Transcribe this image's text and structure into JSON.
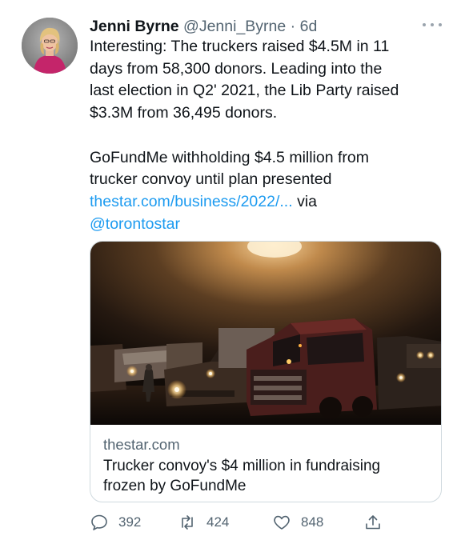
{
  "author": {
    "name": "Jenni Byrne",
    "handle": "@Jenni_Byrne",
    "separator": "·",
    "time": "6d"
  },
  "tweet": {
    "lines": [
      "Interesting: The truckers raised $4.5M in 11",
      "days from 58,300 donors. Leading into the",
      "last election in Q2' 2021, the Lib Party raised",
      "$3.3M from 36,495 donors."
    ],
    "headline_lines": [
      "GoFundMe withholding $4.5 million from",
      "trucker convoy until plan presented"
    ],
    "link_text": "thestar.com/business/2022/...",
    "via_text": " via",
    "mention": "@torontostar"
  },
  "card": {
    "domain": "thestar.com",
    "title_lines": [
      "Trucker convoy's $4 million in fundraising",
      "frozen by GoFundMe"
    ]
  },
  "actions": {
    "reply_count": "392",
    "retweet_count": "424",
    "like_count": "848"
  },
  "icons": {
    "reply": "speech-bubble-icon",
    "retweet": "retweet-arrows-icon",
    "like": "heart-icon",
    "share": "share-upload-icon",
    "more": "more-dots-icon"
  },
  "colors": {
    "link": "#1d9bf0",
    "secondary_text": "#536471",
    "border": "#cfd9de"
  }
}
